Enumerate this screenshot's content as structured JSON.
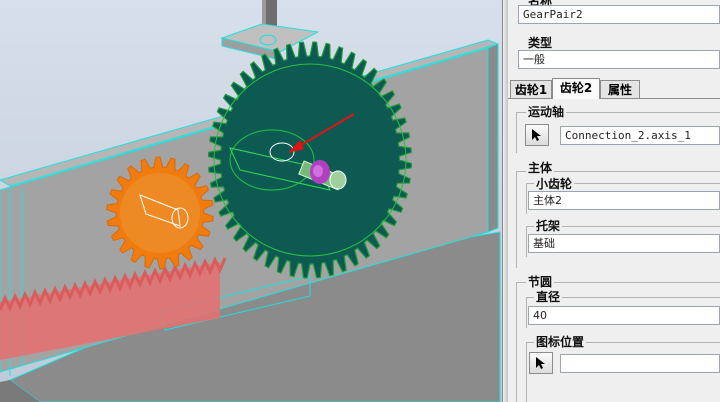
{
  "properties": {
    "name_label": "名称",
    "name_value": "GearPair2",
    "type_label": "类型",
    "type_value": "一般",
    "tabs": [
      {
        "label": "齿轮1",
        "active": false
      },
      {
        "label": "齿轮2",
        "active": true
      },
      {
        "label": "属性",
        "active": false
      }
    ],
    "motion_axis": {
      "label": "运动轴",
      "value": "Connection_2.axis_1",
      "select_icon": "arrow-cursor-icon"
    },
    "body": {
      "label": "主体",
      "pinion": {
        "label": "小齿轮",
        "value": "主体2"
      },
      "carrier": {
        "label": "托架",
        "value": "基础"
      }
    },
    "pitch_circle": {
      "label": "节圆",
      "diameter": {
        "label": "直径",
        "value": "40"
      },
      "icon_position": {
        "label": "图标位置",
        "value": "",
        "select_icon": "arrow-cursor-icon"
      }
    }
  },
  "viewport": {
    "background_color": "#c5cfdf",
    "highlight_color": "#1fe0e0",
    "large_gear_color": "#0c5a52",
    "small_gear_color": "#f07c10",
    "rack_color": "#e87070",
    "arrow_color": "#e01414",
    "pin_color": "#b040c0"
  }
}
